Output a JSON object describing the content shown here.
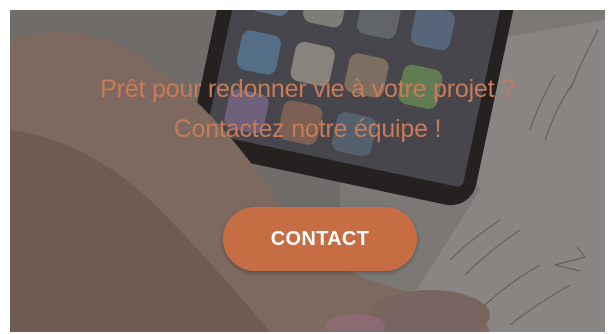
{
  "cta_section": {
    "headline_line1": "Prêt pour redonner vie à votre projet ?",
    "headline_line2": "Contactez notre équipe !",
    "button_label": "CONTACT"
  },
  "colors": {
    "accent": "#c66d44",
    "headline": "#c97a57"
  }
}
